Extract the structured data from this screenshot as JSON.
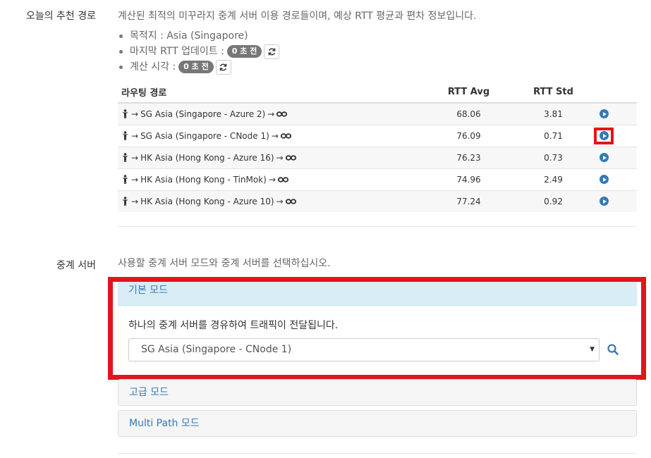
{
  "recommend": {
    "label": "오늘의 추천 경로",
    "description": "계산된 최적의 미꾸라지 중계 서버 이용 경로들이며, 예상 RTT 평균과 편차 정보입니다.",
    "destination": "목적지 : Asia (Singapore)",
    "last_update_label": "마지막 RTT 업데이트 :",
    "last_update_badge": "0 초 전",
    "calc_time_label": "계산 시각 :",
    "calc_time_badge": "0 초 전"
  },
  "table": {
    "headers": {
      "route": "라우팅 경로",
      "avg": "RTT Avg",
      "std": "RTT Std"
    },
    "rows": [
      {
        "route": "SG Asia (Singapore - Azure 2)",
        "avg": "68.06",
        "std": "3.81"
      },
      {
        "route": "SG Asia (Singapore - CNode 1)",
        "avg": "76.09",
        "std": "0.71"
      },
      {
        "route": "HK Asia (Hong Kong - Azure 16)",
        "avg": "76.23",
        "std": "0.73"
      },
      {
        "route": "HK Asia (Hong Kong - TinMok)",
        "avg": "74.96",
        "std": "2.49"
      },
      {
        "route": "HK Asia (Hong Kong - Azure 10)",
        "avg": "77.24",
        "std": "0.92"
      }
    ],
    "arrow": "→"
  },
  "relay": {
    "label": "중계 서버",
    "description": "사용할 중계 서버 모드와 중계 서버를 선택하십시오.",
    "basic_mode": "기본 모드",
    "basic_desc": "하나의 중계 서버를 경유하여 트래픽이 전달됩니다.",
    "selected_server": "SG Asia (Singapore - CNode 1)",
    "advanced_mode": "고급 모드",
    "multipath_mode": "Multi Path 모드"
  },
  "colors": {
    "accent": "#337ab7",
    "highlight": "#e3141e"
  }
}
